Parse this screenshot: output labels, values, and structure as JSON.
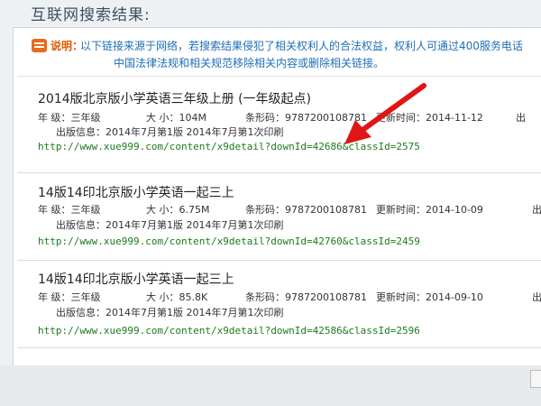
{
  "page": {
    "title": "互联网搜索结果:"
  },
  "notice": {
    "label": "说明：",
    "line1": "以下链接来源于网络，若搜索结果侵犯了相关权利人的合法权益，权利人可通过400服务电话",
    "line2": "中国法律法规和相关规范移除相关内容或删除相关链接。"
  },
  "results": [
    {
      "title": "2014版北京版小学英语三年级上册 (一年级起点)",
      "grade_label": "年   级：三年级",
      "size_label": "大   小：104M",
      "barcode_label": "条形码：9787200108781",
      "updated_label": "更新时间：2014-11-12",
      "publisher_label": "出",
      "pubinfo_label": "出版信息：2014年7月第1版 2014年7月第1次印刷",
      "url": "http://www.xue999.com/content/x9detail?downId=42686&classId=2575"
    },
    {
      "title": "14版14印北京版小学英语一起三上",
      "grade_label": "年   级：三年级",
      "size_label": "大   小：6.75M",
      "barcode_label": "条形码：9787200108781",
      "updated_label": "更新时间：2014-10-09",
      "publisher_label": "出",
      "pubinfo_label": "出版信息：2014年7月第1版 2014年7月第1次印刷",
      "url": "http://www.xue999.com/content/x9detail?downId=42760&classId=2459"
    },
    {
      "title": "14版14印北京版小学英语一起三上",
      "grade_label": "年   级：三年级",
      "size_label": "大   小：85.8K",
      "barcode_label": "条形码：9787200108781",
      "updated_label": "更新时间：2014-09-10",
      "publisher_label": "出",
      "pubinfo_label": "出版信息：2014年7月第1版 2014年7月第1次印刷",
      "url": "http://www.xue999.com/content/x9detail?downId=42586&classId=2596"
    }
  ],
  "colors": {
    "accent": "#e86a1c",
    "link": "#1d7a1d",
    "notice": "#1e6fb8",
    "arrow": "#e01515"
  },
  "icons": {
    "notice": "notice-icon"
  }
}
